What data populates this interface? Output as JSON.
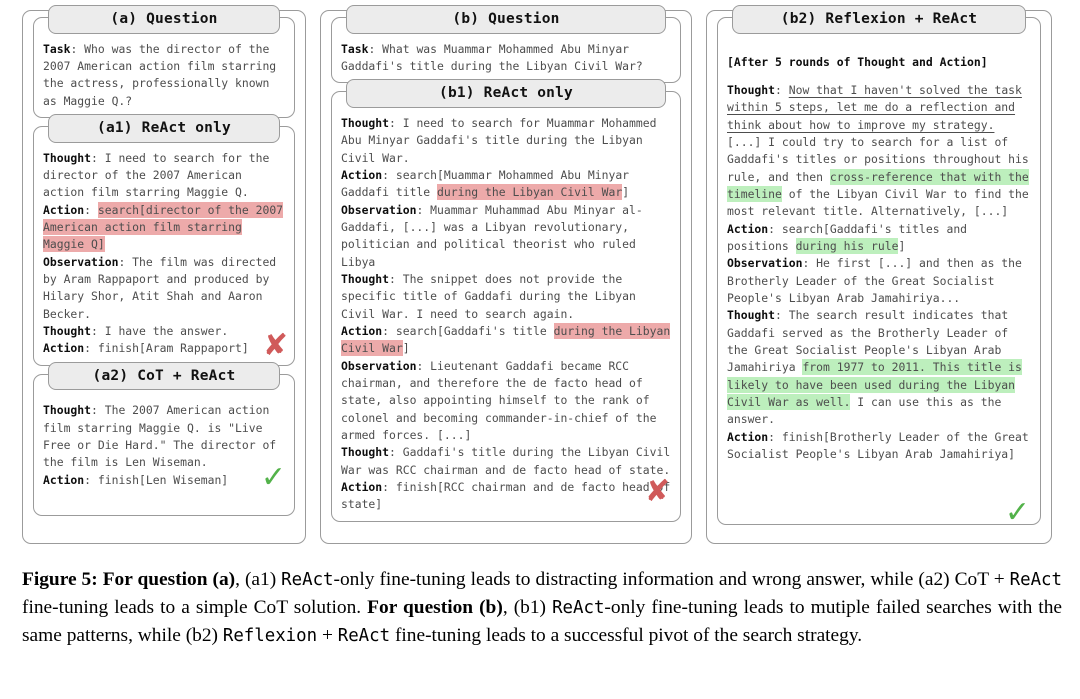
{
  "figure": {
    "columns": [
      {
        "id": "col-a",
        "panels": [
          {
            "id": "a-question",
            "title": "(a) Question",
            "lines": [
              [
                {
                  "t": "Task",
                  "s": "label"
                },
                {
                  "t": ": Who was the director of the 2007 American action film starring the actress, professionally known as Maggie Q.?",
                  "s": "plain"
                }
              ]
            ]
          },
          {
            "id": "a1-react-only",
            "title": "(a1) ReAct only",
            "verdict": "x",
            "lines": [
              [
                {
                  "t": "Thought",
                  "s": "label"
                },
                {
                  "t": ": I need to search for the director of the 2007 American action film starring Maggie Q.",
                  "s": "plain"
                }
              ],
              [
                {
                  "t": "Action",
                  "s": "label"
                },
                {
                  "t": ": ",
                  "s": "plain"
                },
                {
                  "t": "search[director of the 2007 American action film starring Maggie Q]",
                  "s": "red"
                }
              ],
              [
                {
                  "t": "Observation",
                  "s": "label"
                },
                {
                  "t": ": The film was directed by Aram Rappaport and produced by Hilary Shor, Atit Shah and Aaron Becker.",
                  "s": "plain"
                }
              ],
              [
                {
                  "t": "Thought",
                  "s": "label"
                },
                {
                  "t": ": I have the answer.",
                  "s": "plain"
                }
              ],
              [
                {
                  "t": "Action",
                  "s": "label"
                },
                {
                  "t": ": finish[Aram Rappaport]",
                  "s": "plain"
                }
              ]
            ]
          },
          {
            "id": "a2-cot-react",
            "title": "(a2) CoT + ReAct",
            "verdict": "check",
            "lines": [
              [
                {
                  "t": "Thought",
                  "s": "label"
                },
                {
                  "t": ": The 2007 American action film starring Maggie Q. is \"Live Free or Die Hard.\" The director of the film is Len Wiseman.",
                  "s": "plain"
                }
              ],
              [
                {
                  "t": "Action",
                  "s": "label"
                },
                {
                  "t": ": finish[Len Wiseman]",
                  "s": "plain"
                }
              ]
            ]
          }
        ]
      },
      {
        "id": "col-b",
        "panels": [
          {
            "id": "b-question",
            "title": "(b) Question",
            "lines": [
              [
                {
                  "t": "Task",
                  "s": "label"
                },
                {
                  "t": ": What was Muammar Mohammed Abu Minyar Gaddafi's title during the Libyan Civil War?",
                  "s": "plain"
                }
              ]
            ]
          },
          {
            "id": "b1-react-only",
            "title": "(b1) ReAct only",
            "verdict": "x",
            "lines": [
              [
                {
                  "t": "Thought",
                  "s": "label"
                },
                {
                  "t": ": I need to search for Muammar Mohammed Abu Minyar Gaddafi's title during the Libyan Civil War.",
                  "s": "plain"
                }
              ],
              [
                {
                  "t": "Action",
                  "s": "label"
                },
                {
                  "t": ": search[Muammar Mohammed Abu Minyar Gaddafi title ",
                  "s": "plain"
                },
                {
                  "t": "during the Libyan Civil War",
                  "s": "red"
                },
                {
                  "t": "]",
                  "s": "plain"
                }
              ],
              [
                {
                  "t": "Observation",
                  "s": "label"
                },
                {
                  "t": ": Muammar Muhammad Abu Minyar al-Gaddafi, [...] was a Libyan revolutionary, politician and political theorist who ruled Libya",
                  "s": "plain"
                }
              ],
              [
                {
                  "t": "Thought",
                  "s": "label"
                },
                {
                  "t": ": The snippet does not provide the specific title of Gaddafi during the Libyan Civil War. I need to search again.",
                  "s": "plain"
                }
              ],
              [
                {
                  "t": "Action",
                  "s": "label"
                },
                {
                  "t": ": search[Gaddafi's title ",
                  "s": "plain"
                },
                {
                  "t": "during the Libyan Civil War",
                  "s": "red"
                },
                {
                  "t": "]",
                  "s": "plain"
                }
              ],
              [
                {
                  "t": "Observation",
                  "s": "label"
                },
                {
                  "t": ": Lieutenant Gaddafi became RCC chairman, and therefore the de facto head of state, also appointing himself to the rank of colonel and becoming commander-in-chief of the armed forces. [...]",
                  "s": "plain"
                }
              ],
              [
                {
                  "t": "Thought",
                  "s": "label"
                },
                {
                  "t": ": Gaddafi's title during the Libyan Civil War was RCC chairman and de facto head of state.",
                  "s": "plain"
                }
              ],
              [
                {
                  "t": "Action",
                  "s": "label"
                },
                {
                  "t": ": finish[RCC chairman and de facto head of state]",
                  "s": "plain"
                }
              ]
            ]
          }
        ]
      },
      {
        "id": "col-c",
        "panels": [
          {
            "id": "b2-reflexion-react",
            "title": "(b2) Reflexion + ReAct",
            "verdict": "check",
            "lines": [
              [
                {
                  "t": "[After 5 rounds of Thought and Action]",
                  "s": "label"
                }
              ],
              [
                {
                  "t": "",
                  "s": "blank"
                }
              ],
              [
                {
                  "t": "Thought",
                  "s": "label"
                },
                {
                  "t": ": ",
                  "s": "plain"
                },
                {
                  "t": "Now that I haven't solved the task within 5 steps, let me do a reflection and think about how to improve my strategy.",
                  "s": "underline"
                },
                {
                  "t": " [...] I could try to search for a list of Gaddafi's titles or positions throughout his rule, and then ",
                  "s": "plain"
                },
                {
                  "t": "cross-reference that with the timeline",
                  "s": "green"
                },
                {
                  "t": " of the Libyan Civil War to find the most relevant title. Alternatively, [...]",
                  "s": "plain"
                }
              ],
              [
                {
                  "t": "Action",
                  "s": "label"
                },
                {
                  "t": ": search[Gaddafi's titles and positions ",
                  "s": "plain"
                },
                {
                  "t": "during his rule",
                  "s": "green"
                },
                {
                  "t": "]",
                  "s": "plain"
                }
              ],
              [
                {
                  "t": "Observation",
                  "s": "label"
                },
                {
                  "t": ": He first [...] and then as the Brotherly Leader of the Great Socialist People's Libyan Arab Jamahiriya...",
                  "s": "plain"
                }
              ],
              [
                {
                  "t": "Thought",
                  "s": "label"
                },
                {
                  "t": ": The search result indicates that Gaddafi served as the Brotherly Leader of the Great Socialist People's Libyan Arab Jamahiriya ",
                  "s": "plain"
                },
                {
                  "t": "from 1977 to 2011. This title is likely to have been used during the Libyan Civil War as well.",
                  "s": "green"
                },
                {
                  "t": " I can use this as the answer.",
                  "s": "plain"
                }
              ],
              [
                {
                  "t": "Action",
                  "s": "label"
                },
                {
                  "t": ": finish[Brotherly Leader of the Great Socialist People's Libyan Arab Jamahiriya]",
                  "s": "plain"
                }
              ]
            ]
          }
        ]
      }
    ]
  },
  "caption": {
    "figure_label": "Figure 5:",
    "segments": [
      {
        "t": " ",
        "s": "plain"
      },
      {
        "t": "For question (a)",
        "s": "bold"
      },
      {
        "t": ", (a1) ",
        "s": "plain"
      },
      {
        "t": "ReAct",
        "s": "mono"
      },
      {
        "t": "-only fine-tuning leads to distracting information and wrong answer, while (a2) CoT + ",
        "s": "plain"
      },
      {
        "t": "ReAct",
        "s": "mono"
      },
      {
        "t": " fine-tuning leads to a simple CoT solution. ",
        "s": "plain"
      },
      {
        "t": "For question (b)",
        "s": "bold"
      },
      {
        "t": ", (b1) ",
        "s": "plain"
      },
      {
        "t": "ReAct",
        "s": "mono"
      },
      {
        "t": "-only fine-tuning leads to mutiple failed searches with the same patterns, while (b2) ",
        "s": "plain"
      },
      {
        "t": "Reflexion",
        "s": "mono"
      },
      {
        "t": " + ",
        "s": "plain"
      },
      {
        "t": "ReAct",
        "s": "mono"
      },
      {
        "t": " fine-tuning leads to a successful pivot of the search strategy.",
        "s": "plain"
      }
    ]
  },
  "marks": {
    "fail": "✘",
    "success": "✓"
  },
  "colors": {
    "highlight_red": "#edaaaa",
    "highlight_green": "#bdefbd",
    "header_bg": "#ececec",
    "border": "#9b9b9b",
    "mark_fail": "#d05a5a",
    "mark_success": "#53b24a"
  }
}
